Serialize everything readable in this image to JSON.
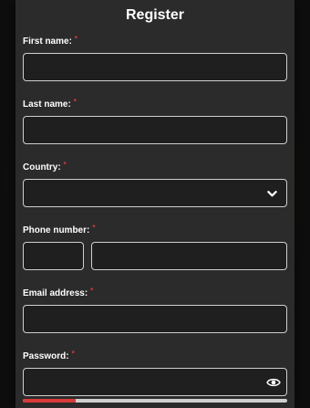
{
  "form": {
    "title": "Register",
    "first_name": {
      "label": "First name:",
      "required_mark": "*",
      "value": ""
    },
    "last_name": {
      "label": "Last name:",
      "required_mark": "*",
      "value": ""
    },
    "country": {
      "label": "Country:",
      "required_mark": "*",
      "selected": ""
    },
    "phone": {
      "label": "Phone number:",
      "required_mark": "*",
      "code": "",
      "number": ""
    },
    "email": {
      "label": "Email address:",
      "required_mark": "*",
      "value": ""
    },
    "password": {
      "label": "Password:",
      "required_mark": "*",
      "value": ""
    },
    "password_strength": 0.2
  },
  "colors": {
    "panel": "#2b2b2b",
    "field_bg": "#1f1f1f",
    "field_border": "#cfcfcf",
    "required": "#d93a3a",
    "strength_fill": "#d93a3a"
  },
  "icons": {
    "country_dropdown": "chevron-down-icon",
    "password_toggle": "eye-icon"
  }
}
